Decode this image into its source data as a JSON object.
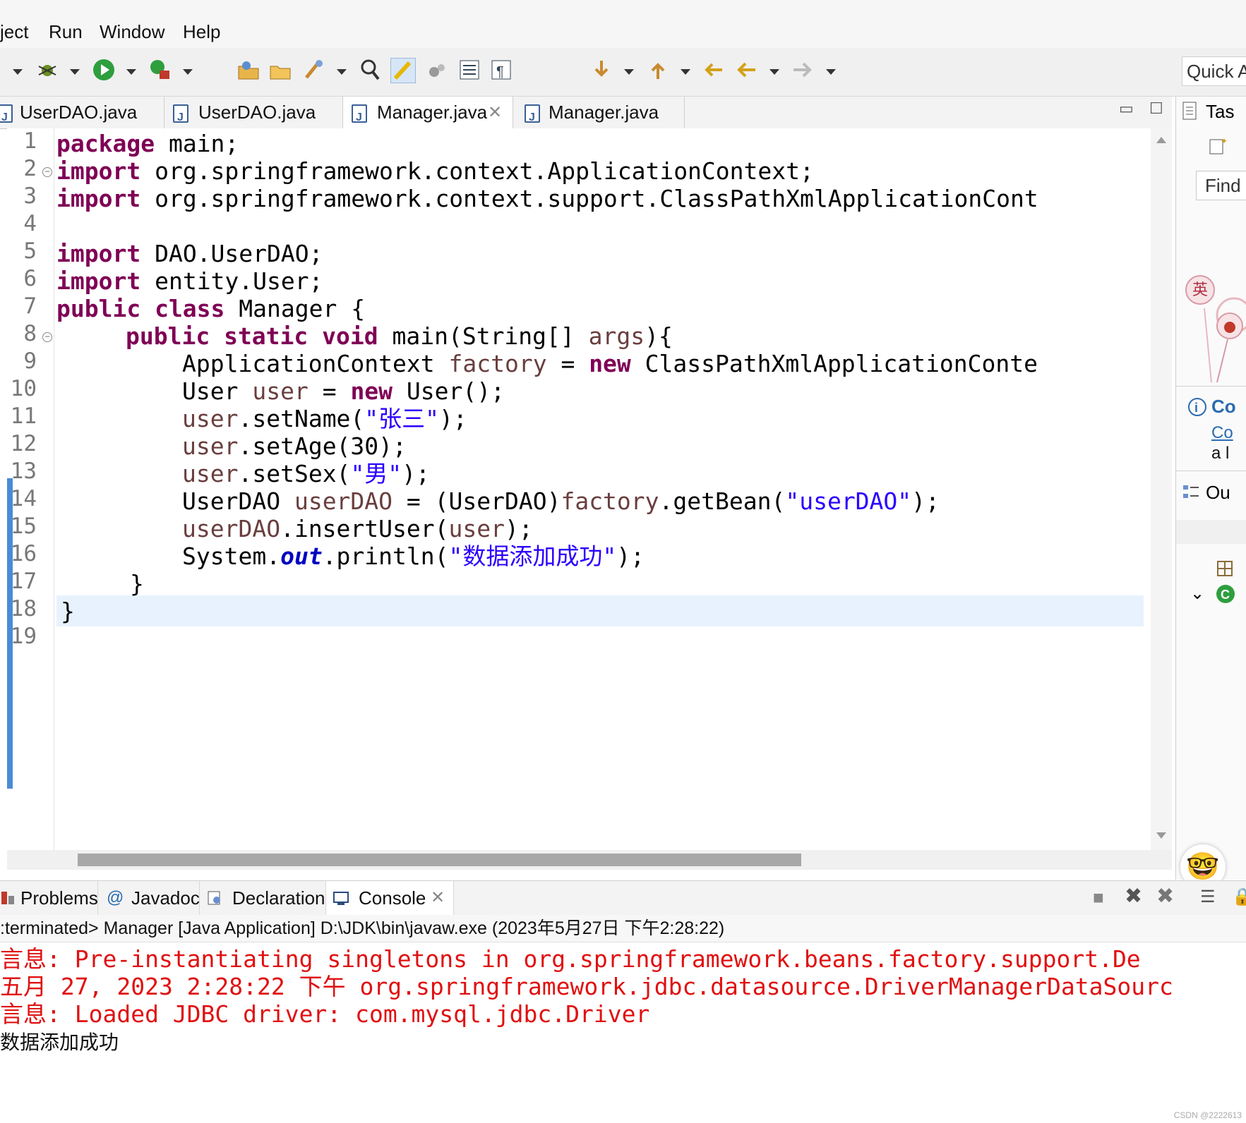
{
  "menu": [
    "ject",
    "Run",
    "Window",
    "Help"
  ],
  "toolbar": {
    "quick_access": "Quick A",
    "icons": [
      "debug-icon",
      "run-icon",
      "external-tools-icon",
      "open-type-icon",
      "open-task-icon",
      "search-icon",
      "toggle-mark-occurrences-icon",
      "block-selection-icon",
      "show-whitespace-icon",
      "next-annotation-icon",
      "prev-annotation-icon",
      "last-edit-icon",
      "back-icon",
      "forward-icon"
    ]
  },
  "editor": {
    "tabs": [
      {
        "label": "UserDAO.java",
        "active": false
      },
      {
        "label": "UserDAO.java",
        "active": false
      },
      {
        "label": "Manager.java",
        "active": true
      },
      {
        "label": "Manager.java",
        "active": false
      }
    ],
    "line_numbers": [
      "1",
      "2",
      "3",
      "4",
      "5",
      "6",
      "7",
      "8",
      "9",
      "10",
      "11",
      "12",
      "13",
      "14",
      "15",
      "16",
      "17",
      "18",
      "19"
    ]
  },
  "code": {
    "l1_kw": "package",
    "l1_rest": " main;",
    "l2_kw": "import",
    "l2_rest": " org.springframework.context.ApplicationContext;",
    "l3_kw": "import",
    "l3_rest": " org.springframework.context.support.ClassPathXmlApplicationCont",
    "l5_kw": "import",
    "l5_rest": " DAO.UserDAO;",
    "l6_kw": "import",
    "l6_rest": " entity.User;",
    "l7_kw": "public class",
    "l7_rest": " Manager {",
    "l8_kw": "public static void",
    "l8_a": " main(String[] ",
    "l8_var": "args",
    "l8_b": "){",
    "l9_a": "ApplicationContext ",
    "l9_var": "factory",
    "l9_b": " = ",
    "l9_kw": "new",
    "l9_c": " ClassPathXmlApplicationConte",
    "l10_a": "User ",
    "l10_var": "user",
    "l10_b": " = ",
    "l10_kw": "new",
    "l10_c": " User();",
    "l11_var": "user",
    "l11_a": ".setName(",
    "l11_str": "\"张三\"",
    "l11_b": ");",
    "l12_var": "user",
    "l12_a": ".setAge(30);",
    "l13_var": "user",
    "l13_a": ".setSex(",
    "l13_str": "\"男\"",
    "l13_b": ");",
    "l14_a": "UserDAO ",
    "l14_var": "userDAO",
    "l14_b": " = (UserDAO)",
    "l14_var2": "factory",
    "l14_c": ".getBean(",
    "l14_str": "\"userDAO\"",
    "l14_d": ");",
    "l15_var": "userDAO",
    "l15_a": ".insertUser(",
    "l15_var2": "user",
    "l15_b": ");",
    "l16_a": "System.",
    "l16_fld": "out",
    "l16_b": ".println(",
    "l16_str": "\"数据添加成功\"",
    "l16_c": ");",
    "l17": "}",
    "l18": "}"
  },
  "right_panel": {
    "tasks_label": "Tas",
    "find_label": "Find",
    "ying_badge": "英",
    "info_label": "Co",
    "info_link": "Co",
    "info_text": "a l",
    "outline_label": "Ou"
  },
  "console": {
    "tabs": [
      {
        "label": "Problems",
        "icon": "problems-icon"
      },
      {
        "label": "Javadoc",
        "icon": "javadoc-icon"
      },
      {
        "label": "Declaration",
        "icon": "declaration-icon"
      },
      {
        "label": "Console",
        "icon": "console-icon",
        "active": true
      }
    ],
    "header": ":terminated> Manager [Java Application] D:\\JDK\\bin\\javaw.exe (2023年5月27日 下午2:28:22)",
    "lines": [
      "言息: Pre-instantiating singletons in org.springframework.beans.factory.support.De",
      "五月 27, 2023 2:28:22 下午 org.springframework.jdbc.datasource.DriverManagerDataSourc",
      "言息: Loaded JDBC driver: com.mysql.jdbc.Driver"
    ],
    "output": "数据添加成功"
  },
  "watermark": "CSDN @2222613"
}
